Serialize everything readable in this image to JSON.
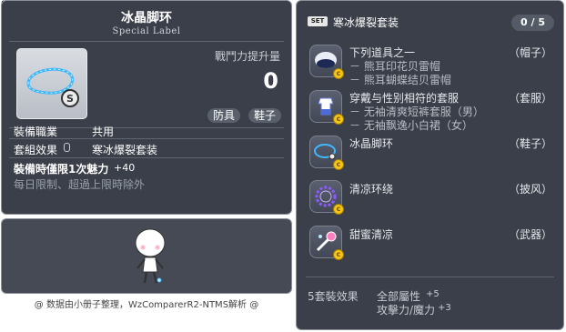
{
  "item_id": "01073669",
  "item": {
    "name": "冰晶脚环",
    "label": "Special Label",
    "power_label": "戰鬥力提升量",
    "power_value": "0",
    "tags": [
      "防具",
      "鞋子"
    ],
    "job_label": "裝備職業",
    "job_value": "共用",
    "set_label": "套組效果",
    "set_value": "寒冰爆裂套装",
    "bonus_text": "裝備時僅限1次魅力",
    "bonus_value": "+40",
    "limit_text": "每日限制、超過上限時除外"
  },
  "set": {
    "badge": "SET",
    "name": "寒冰爆裂套装",
    "count": "0 / 5",
    "items": [
      {
        "name": "下列道具之一",
        "subs": [
          "－ 熊耳印花贝雷帽",
          "－ 熊耳蝴蝶结贝雷帽"
        ],
        "slot": "（帽子）",
        "icon": "beret-icon"
      },
      {
        "name": "穿戴与性别相符的套服",
        "subs": [
          "－ 无袖清爽短裤套服（男）",
          "－ 无袖飘逸小白裙（女）"
        ],
        "slot": "（套服）",
        "icon": "outfit-icon"
      },
      {
        "name": "冰晶脚环",
        "subs": [],
        "slot": "（鞋子）",
        "icon": "anklet-icon"
      },
      {
        "name": "清凉环绕",
        "subs": [],
        "slot": "（披风）",
        "icon": "ring-aura-icon"
      },
      {
        "name": "甜蜜清凉",
        "subs": [],
        "slot": "（武器）",
        "icon": "candy-weapon-icon"
      }
    ],
    "effect_label": "5套裝效果",
    "effects": [
      {
        "stat": "全部屬性",
        "value": "+5"
      },
      {
        "stat": "攻擊力/魔力",
        "value": "+3"
      }
    ]
  },
  "footer": "@ 数据由小册子整理，WzComparerR2-NTMS解析 @",
  "colors": {
    "panel": "#3a3f49",
    "border": "#8a909b",
    "coin": "#f5c518"
  }
}
